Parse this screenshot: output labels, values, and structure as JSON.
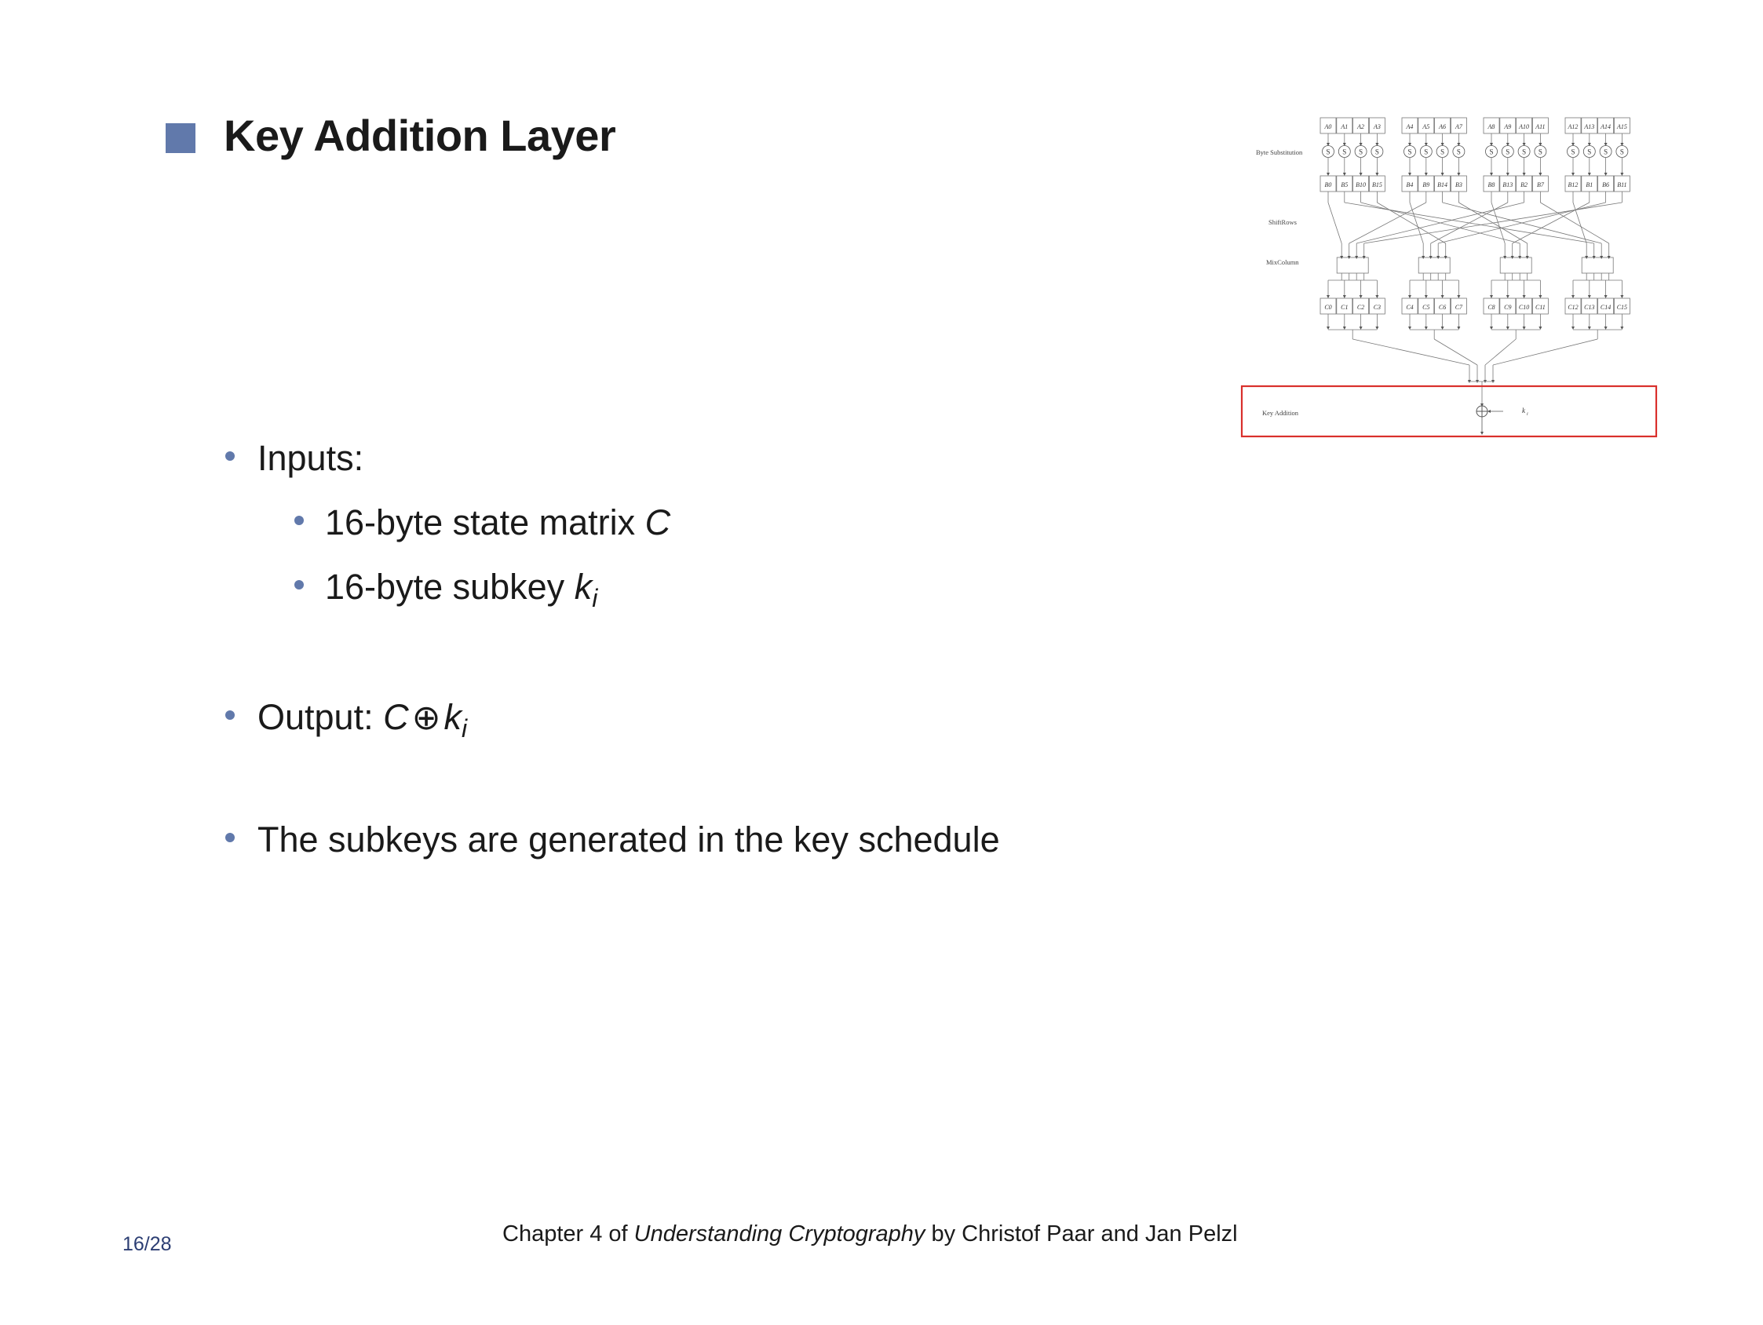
{
  "slide": {
    "title": "Key Addition Layer",
    "page_number": "16/28"
  },
  "bullets": {
    "inputs_label": "Inputs:",
    "sub1_text": "16-byte state matrix ",
    "sub1_var": "C",
    "sub2_text": "16-byte subkey ",
    "sub2_var": "k",
    "sub2_sub": "i",
    "output_label": "Output: ",
    "output_c": "C",
    "output_op": "⊕",
    "output_k": "k",
    "output_sub": "i",
    "schedule": "The subkeys are generated in the key schedule"
  },
  "footer": {
    "prefix": "Chapter 4 of ",
    "book": "Understanding Cryptography",
    "suffix": " by Christof Paar and Jan Pelzl"
  },
  "diagram": {
    "byte_substitution_label": "Byte Substitution",
    "shiftrows_label": "ShiftRows",
    "mixcolumn_label": "MixColumn",
    "key_addition_label": "Key Addition",
    "sbox_symbol": "S",
    "key_symbol": "k",
    "key_sub": "i",
    "a_cells": [
      "A0",
      "A1",
      "A2",
      "A3",
      "A4",
      "A5",
      "A6",
      "A7",
      "A8",
      "A9",
      "A10",
      "A11",
      "A12",
      "A13",
      "A14",
      "A15"
    ],
    "b_cells": [
      "B0",
      "B5",
      "B10",
      "B15",
      "B4",
      "B9",
      "B14",
      "B3",
      "B8",
      "B13",
      "B2",
      "B7",
      "B12",
      "B1",
      "B6",
      "B11"
    ],
    "c_cells": [
      "C0",
      "C1",
      "C2",
      "C3",
      "C4",
      "C5",
      "C6",
      "C7",
      "C8",
      "C9",
      "C10",
      "C11",
      "C12",
      "C13",
      "C14",
      "C15"
    ],
    "highlight_color": "#d9302c"
  }
}
